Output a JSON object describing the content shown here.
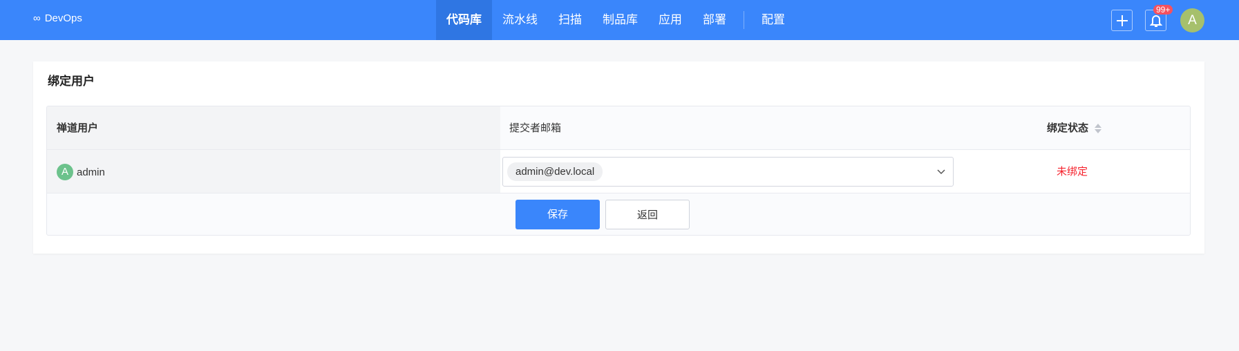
{
  "header": {
    "logo": "DevOps",
    "nav": [
      "代码库",
      "流水线",
      "扫描",
      "制品库",
      "应用",
      "部署"
    ],
    "nav_extra": "配置",
    "active": "代码库",
    "badge": "99+",
    "avatar": "A"
  },
  "card": {
    "title": "绑定用户",
    "columns": [
      "禅道用户",
      "提交者邮箱",
      "绑定状态"
    ],
    "rows": [
      {
        "avatar": "A",
        "user": "admin",
        "email": "admin@dev.local",
        "status": "未绑定"
      }
    ],
    "save": "保存",
    "back": "返回"
  },
  "colors": {
    "brand": "#3a86fb",
    "unbound": "#f5222d"
  }
}
